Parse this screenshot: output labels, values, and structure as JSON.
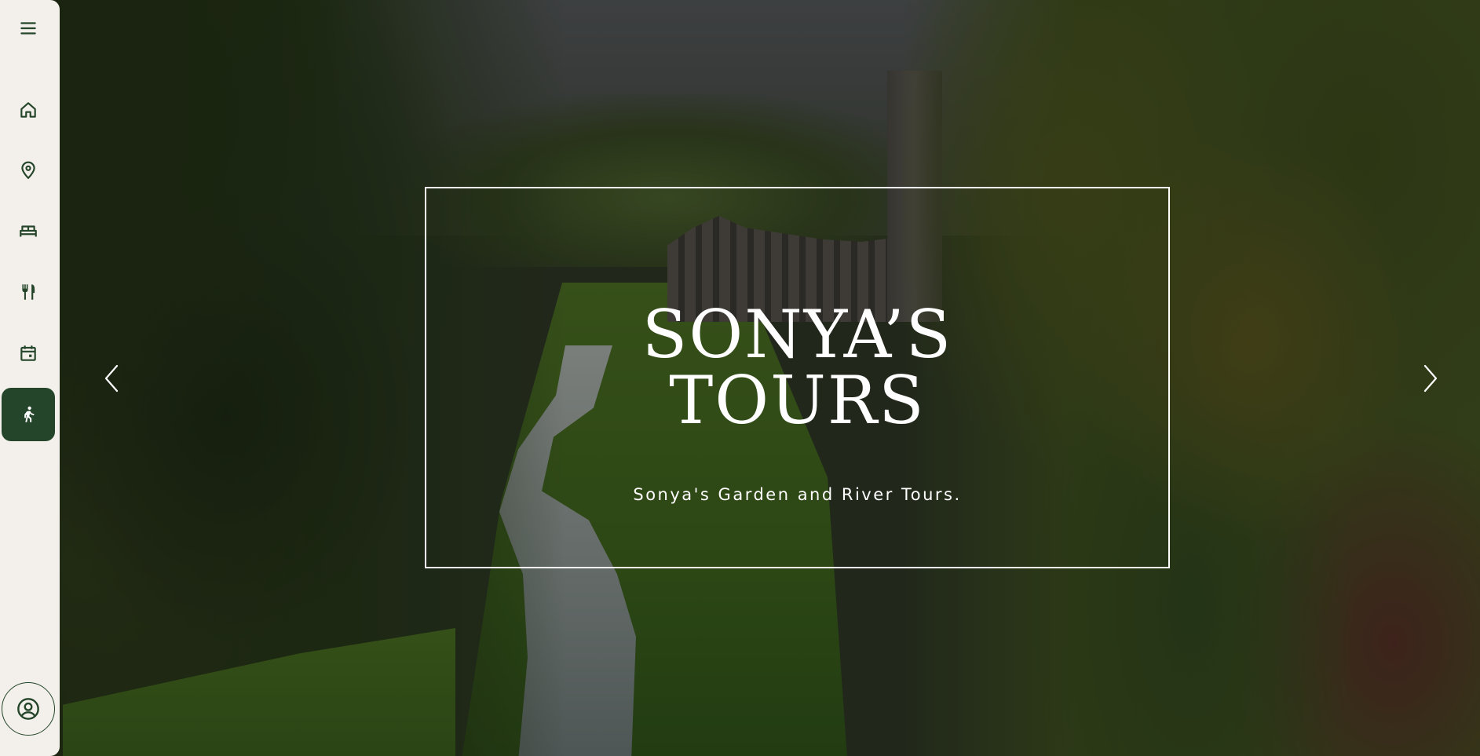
{
  "sidebar": {
    "items": [
      {
        "name": "menu",
        "icon": "menu-icon"
      },
      {
        "name": "home",
        "icon": "home-icon"
      },
      {
        "name": "locations",
        "icon": "location-pin-icon"
      },
      {
        "name": "stay",
        "icon": "bed-icon"
      },
      {
        "name": "dining",
        "icon": "fork-knife-icon"
      },
      {
        "name": "events",
        "icon": "calendar-icon"
      },
      {
        "name": "tours",
        "icon": "hiking-person-icon",
        "active": true
      }
    ],
    "profile_icon": "account-circle-icon",
    "accent_color": "#24452a",
    "background_color": "#f3f0eb"
  },
  "hero": {
    "title_line1": "SONYA’S",
    "title_line2": "TOURS",
    "subtitle": "Sonya's Garden and River Tours.",
    "prev_icon": "chevron-left-icon",
    "next_icon": "chevron-right-icon"
  }
}
